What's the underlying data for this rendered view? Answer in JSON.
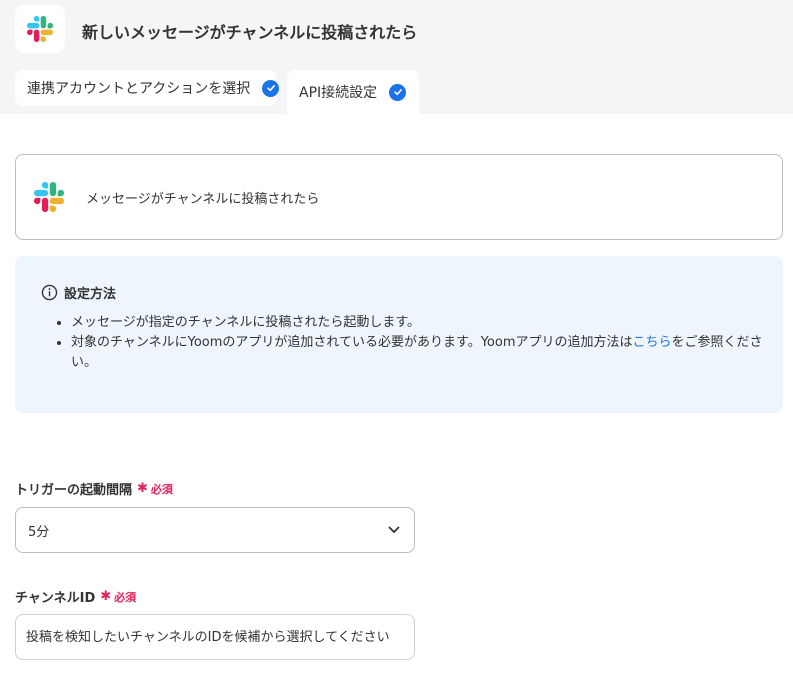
{
  "header": {
    "title": "新しいメッセージがチャンネルに投稿されたら",
    "app_icon": "slack-logo-icon",
    "tabs": [
      {
        "label": "連携アカウントとアクションを選択",
        "completed": true
      },
      {
        "label": "API接続設定",
        "completed": true,
        "active": true
      }
    ]
  },
  "trigger_card": {
    "icon": "slack-logo-icon",
    "name": "メッセージがチャンネルに投稿されたら"
  },
  "info": {
    "title": "設定方法",
    "items": [
      "メッセージが指定のチャンネルに投稿されたら起動します。",
      "対象のチャンネルにYoomのアプリが追加されている必要があります。Yoomアプリの追加方法は"
    ],
    "link_text": "こちら",
    "item2_suffix": "をご参照ください。"
  },
  "form": {
    "interval": {
      "label": "トリガーの起動間隔",
      "required_mark": "✱",
      "required_text": "必須",
      "value": "5分"
    },
    "channel_id": {
      "label": "チャンネルID",
      "required_mark": "✱",
      "required_text": "必須",
      "placeholder": "投稿を検知したいチャンネルのIDを候補から選択してください"
    }
  },
  "colors": {
    "accent": "#1a73e8",
    "required": "#e0245e",
    "header_bg": "#f5f5f7",
    "info_bg": "#eff5fd"
  }
}
